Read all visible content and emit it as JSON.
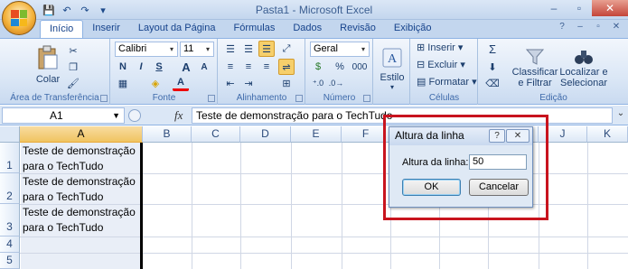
{
  "window": {
    "title": "Pasta1 - Microsoft Excel",
    "minimize": "–",
    "maximize": "▫",
    "close": "✕"
  },
  "quick_access": [
    "save",
    "undo",
    "redo",
    "customize"
  ],
  "tabs": [
    {
      "label": "Início",
      "active": true
    },
    {
      "label": "Inserir"
    },
    {
      "label": "Layout da Página"
    },
    {
      "label": "Fórmulas"
    },
    {
      "label": "Dados"
    },
    {
      "label": "Revisão"
    },
    {
      "label": "Exibição"
    }
  ],
  "ribbon": {
    "clipboard": {
      "paste_label": "Colar",
      "group_label": "Área de Transferência"
    },
    "font": {
      "name": "Calibri",
      "size": "11",
      "bold": "N",
      "italic": "I",
      "underline": "S",
      "grow": "A",
      "shrink": "A",
      "font_color_letter": "A",
      "group_label": "Fonte"
    },
    "alignment": {
      "group_label": "Alinhamento"
    },
    "number": {
      "format": "Geral",
      "currency": "$",
      "percent": "%",
      "thousands": "000",
      "group_label": "Número"
    },
    "styles": {
      "label": "Estilo"
    },
    "cells": {
      "insert": "Inserir",
      "delete": "Excluir",
      "format": "Formatar",
      "group_label": "Células"
    },
    "editing": {
      "sort_filter_1": "Classificar",
      "sort_filter_2": "e Filtrar",
      "find_select_1": "Localizar e",
      "find_select_2": "Selecionar",
      "group_label": "Edição"
    }
  },
  "formula_bar": {
    "name_box": "A1",
    "fx": "fx",
    "content": "Teste de demonstração para o TechTudo"
  },
  "sheet": {
    "columns": [
      "A",
      "B",
      "C",
      "D",
      "E",
      "F",
      "G",
      "H",
      "I",
      "J",
      "K"
    ],
    "rows": [
      "1",
      "2",
      "3",
      "4",
      "5"
    ],
    "cells": {
      "A1_line1": "Teste de demonstração",
      "A1_line2": "para o TechTudo",
      "A2_line1": "Teste de demonstração",
      "A2_line2": "para o TechTudo",
      "A3_line1": "Teste de demonstração",
      "A3_line2": "para o TechTudo"
    }
  },
  "dialog": {
    "title": "Altura da linha",
    "help": "?",
    "close": "✕",
    "label": "Altura da linha:",
    "value": "50",
    "ok": "OK",
    "cancel": "Cancelar"
  },
  "colors": {
    "highlight": "#c8141e",
    "selection_header": "#f0c461",
    "ribbon": "#dbe7f6"
  }
}
